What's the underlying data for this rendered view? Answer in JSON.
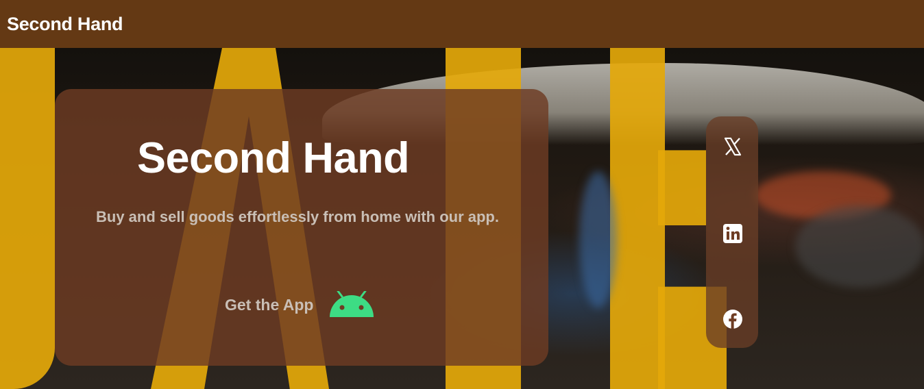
{
  "navbar": {
    "brand": "Second Hand"
  },
  "hero": {
    "title": "Second Hand",
    "description": "Buy and sell goods effortlessly from home with our app.",
    "cta_label": "Get the App",
    "cta_icon": "android-icon",
    "accent_color": "#3ddc84"
  },
  "social": {
    "items": [
      {
        "name": "x-icon",
        "label": "X"
      },
      {
        "name": "linkedin-icon",
        "label": "LinkedIn"
      },
      {
        "name": "facebook-icon",
        "label": "Facebook"
      }
    ]
  },
  "colors": {
    "navbar_bg": "#643914",
    "card_bg": "#6e3c23",
    "text_light": "#c9bfb6",
    "sign_yellow": "#e4a80a"
  }
}
